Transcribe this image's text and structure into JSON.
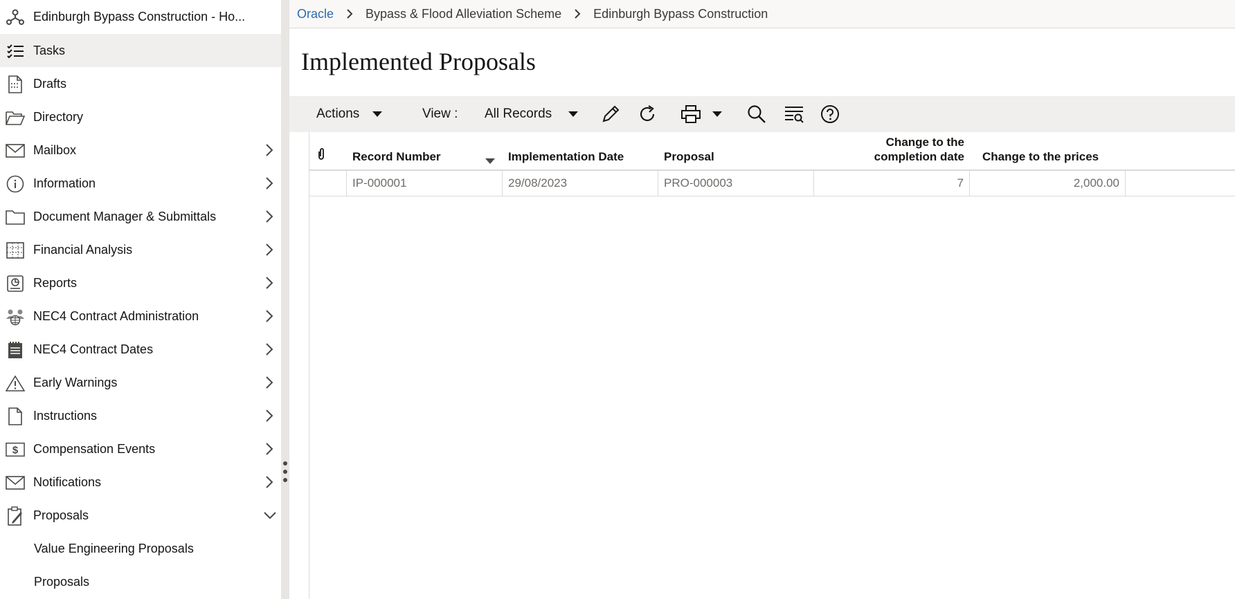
{
  "sidebar": {
    "project_title": "Edinburgh Bypass Construction - Ho...",
    "items": [
      {
        "label": "Tasks"
      },
      {
        "label": "Drafts"
      },
      {
        "label": "Directory"
      },
      {
        "label": "Mailbox"
      },
      {
        "label": "Information"
      },
      {
        "label": "Document Manager & Submittals"
      },
      {
        "label": "Financial Analysis"
      },
      {
        "label": "Reports"
      },
      {
        "label": "NEC4 Contract Administration"
      },
      {
        "label": "NEC4 Contract Dates"
      },
      {
        "label": "Early Warnings"
      },
      {
        "label": "Instructions"
      },
      {
        "label": "Compensation Events"
      },
      {
        "label": "Notifications"
      },
      {
        "label": "Proposals"
      }
    ],
    "sub_items": [
      {
        "label": "Value Engineering Proposals"
      },
      {
        "label": "Proposals"
      }
    ]
  },
  "breadcrumb": [
    "Oracle",
    "Bypass & Flood Alleviation Scheme",
    "Edinburgh Bypass Construction"
  ],
  "page_title": "Implemented Proposals",
  "toolbar": {
    "actions_label": "Actions",
    "view_label": "View :",
    "view_value": "All Records"
  },
  "grid": {
    "columns": [
      "Record Number",
      "Implementation Date",
      "Proposal",
      "Change to the completion date",
      "Change to the prices"
    ],
    "column_line1": "Change to the",
    "column_line2": "completion date",
    "rows": [
      {
        "record_number": "IP-000001",
        "implementation_date": "29/08/2023",
        "proposal": "PRO-000003",
        "change_completion_date": "7",
        "change_prices": "2,000.00"
      }
    ]
  }
}
